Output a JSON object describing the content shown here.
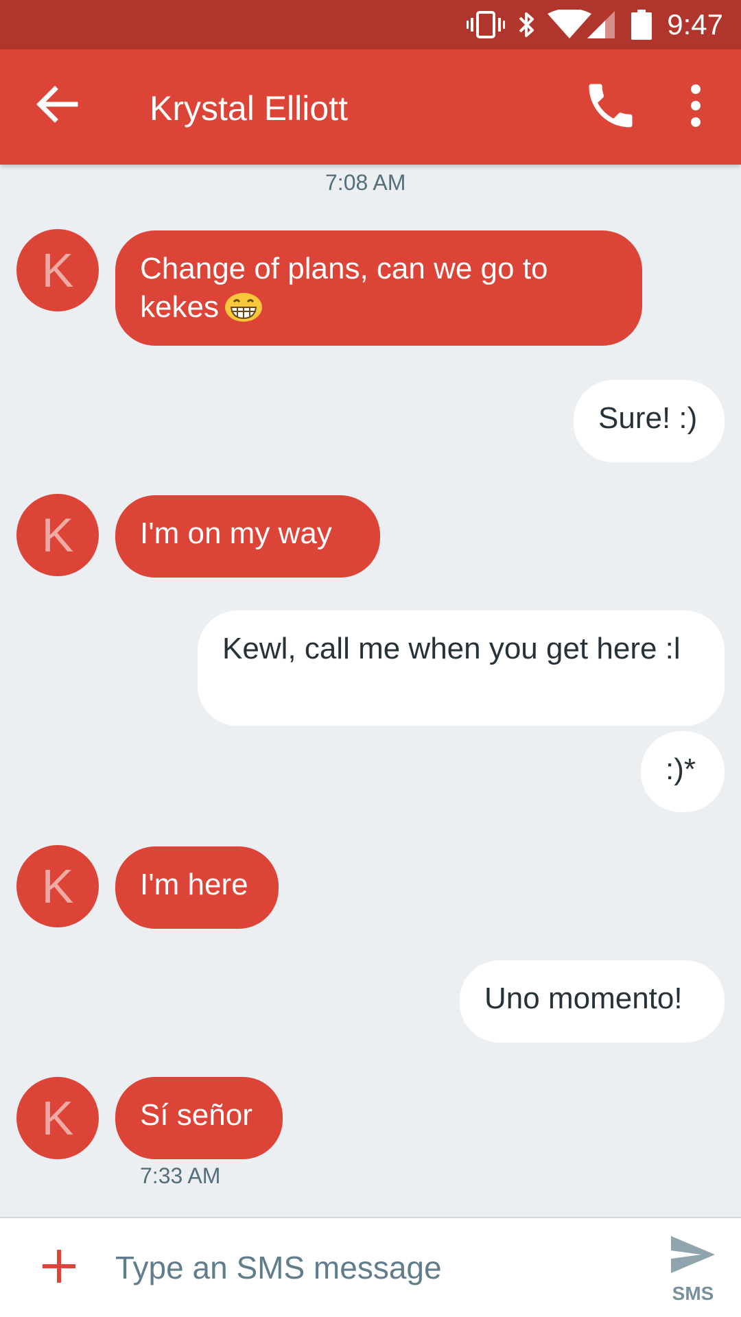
{
  "status_bar": {
    "time": "9:47",
    "icons": [
      "vibrate-icon",
      "bluetooth-icon",
      "wifi-icon",
      "cell-signal-icon",
      "battery-icon"
    ]
  },
  "app_bar": {
    "title": "Krystal Elliott",
    "icons": [
      "back-arrow-icon",
      "phone-icon",
      "more-vert-icon"
    ]
  },
  "colors": {
    "accent": "#db4437",
    "status_bar": "#b0362d",
    "background": "#eceff1",
    "outgoing_bubble": "#ffffff"
  },
  "conversation": {
    "timestamp_top": "7:08 AM",
    "timestamp_bottom": "7:33 AM",
    "avatar_letter": "K",
    "messages": [
      {
        "direction": "incoming",
        "text": "Change of plans, can we go to kekes",
        "emoji": "grinning-face-icon"
      },
      {
        "direction": "outgoing",
        "text": "Sure! :)"
      },
      {
        "direction": "incoming",
        "text": "I'm on my way"
      },
      {
        "direction": "outgoing",
        "text": "Kewl, call me when you get here :l"
      },
      {
        "direction": "outgoing",
        "text": ":)*"
      },
      {
        "direction": "incoming",
        "text": "I'm here"
      },
      {
        "direction": "outgoing",
        "text": "Uno momento!"
      },
      {
        "direction": "incoming",
        "text": "Sí señor"
      }
    ]
  },
  "compose": {
    "placeholder": "Type an SMS message",
    "value": "",
    "send_label": "SMS",
    "icons": [
      "plus-icon",
      "send-icon"
    ]
  }
}
